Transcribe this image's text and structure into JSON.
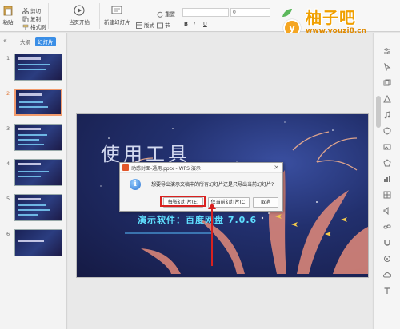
{
  "ribbon": {
    "paste_label": "粘贴",
    "cut_label": "剪切",
    "copy_label": "复制",
    "format_painter_label": "格式刷",
    "play_label": "当页开始",
    "new_slide_label": "新建幻灯片",
    "layout_label": "版式",
    "section_label": "节",
    "reset_label": "重置",
    "font_size_value": "0"
  },
  "logo": {
    "title": "柚子吧",
    "url": "www.youzi8.cn",
    "badge": "y"
  },
  "left_panel": {
    "collapse_icon": "«",
    "tabs": [
      "大纲",
      "幻灯片"
    ],
    "active_tab": 1,
    "slides": [
      "1",
      "2",
      "3",
      "4",
      "5",
      "6"
    ],
    "selected_slide": 2
  },
  "slide": {
    "title": "使用工具",
    "line": "演示软件：百度网盘 7.0.6",
    "number_fragment": "2"
  },
  "dialog": {
    "title": "动感封面-通用.pptx - WPS 演示",
    "message": "想要导出演示文稿中的所有幻灯片还是只导出当前幻灯片?",
    "buttons": [
      "每张幻灯片(E)",
      "仅当前幻灯片(C)",
      "取消"
    ],
    "close_icon": "×",
    "info_icon": "i"
  },
  "colors": {
    "accent": "#3a8ee6",
    "highlight": "#d9211f",
    "logo_orange": "#f0a000"
  }
}
